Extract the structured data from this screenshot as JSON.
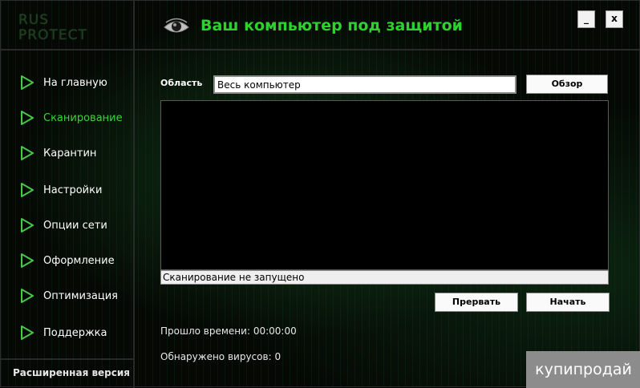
{
  "logo": {
    "line1": "RUS",
    "line2": "PROTECT"
  },
  "header": {
    "title": "Ваш компьютер под защитой",
    "minimize_label": "_",
    "close_label": "x"
  },
  "sidebar": {
    "items": [
      {
        "label": "На главную",
        "active": false
      },
      {
        "label": "Сканирование",
        "active": true
      },
      {
        "label": "Карантин",
        "active": false
      },
      {
        "label": "Настройки",
        "active": false
      },
      {
        "label": "Опции сети",
        "active": false
      },
      {
        "label": "Оформление",
        "active": false
      },
      {
        "label": "Оптимизация",
        "active": false
      },
      {
        "label": "Поддержка",
        "active": false
      }
    ],
    "footer": "Расширенная версия"
  },
  "scan": {
    "area_label": "Область",
    "area_value": "Весь компьютер",
    "browse_label": "Обзор",
    "status": "Сканирование не запущено",
    "stop_label": "Прервать",
    "start_label": "Начать",
    "elapsed_label": "Прошло времени:",
    "elapsed_value": "00:00:00",
    "viruses_label": "Обнаружено вирусов:",
    "viruses_value": "0"
  },
  "watermark": "купипродай",
  "colors": {
    "accent": "#2fd12f",
    "active_nav": "#39d439",
    "background": "#050805"
  },
  "icons": {
    "header": "eye-icon",
    "nav": "play-triangle-icon"
  }
}
